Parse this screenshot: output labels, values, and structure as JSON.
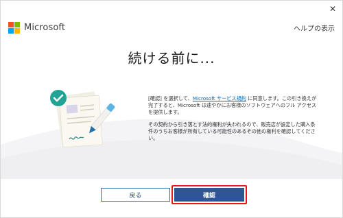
{
  "window": {
    "close_glyph": "✕"
  },
  "brand": {
    "name": "Microsoft",
    "logo_colors": [
      "#f25022",
      "#7fba00",
      "#00a4ef",
      "#ffb900"
    ]
  },
  "header": {
    "help_link": "ヘルプの表示"
  },
  "main": {
    "title": "続ける前に...",
    "paragraph1": {
      "before_link": "[確認] を選択して、",
      "link": "Microsoft サービス規約",
      "after_link": " に同意します。この引き換えが完了すると、Microsoft は速やかにお客様のソフトウェアへのフル アクセスを提供します。"
    },
    "paragraph2": "その契約から引き落とす法的権利が失われるので、販売店が設定した購入条件のうちお客様が所有している可能性のあるその他の権利を確認してください。"
  },
  "footer": {
    "back_label": "戻る",
    "confirm_label": "確認",
    "highlight_color": "#e8151b",
    "primary_color": "#2f5597"
  },
  "icons": {
    "checkmark": "check-circle-icon",
    "pen": "pen-icon",
    "document": "document-icon"
  }
}
